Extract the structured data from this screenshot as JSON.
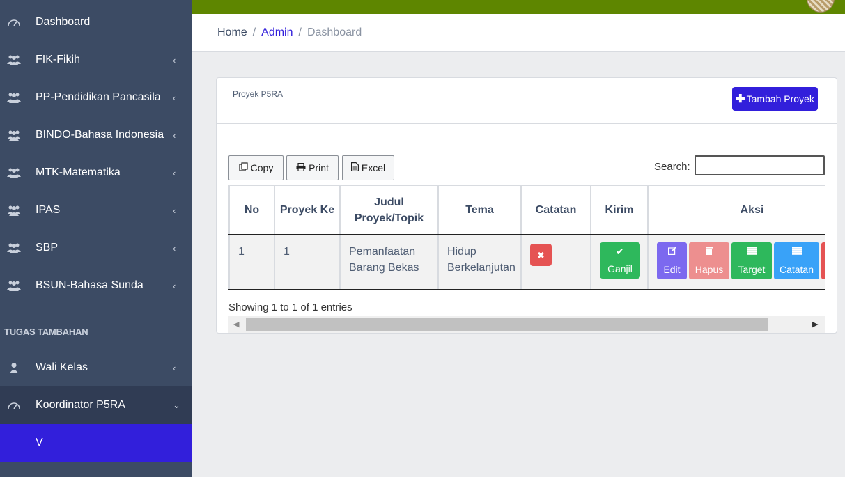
{
  "sidebar": {
    "items": [
      {
        "label": "Dashboard",
        "icon": "speedometer-icon"
      },
      {
        "label": "FIK-Fikih",
        "icon": "people-icon"
      },
      {
        "label": "PP-Pendidikan Pancasila",
        "icon": "people-icon"
      },
      {
        "label": "BINDO-Bahasa Indonesia",
        "icon": "people-icon"
      },
      {
        "label": "MTK-Matematika",
        "icon": "people-icon"
      },
      {
        "label": "IPAS",
        "icon": "people-icon"
      },
      {
        "label": "SBP",
        "icon": "people-icon"
      },
      {
        "label": "BSUN-Bahasa Sunda",
        "icon": "people-icon"
      }
    ],
    "section_title": "TUGAS TAMBAHAN",
    "wali_kelas": "Wali Kelas",
    "koordinator": "Koordinator P5RA",
    "sub_item": "V",
    "chevron_left": "‹",
    "chevron_down": "⌄"
  },
  "breadcrumb": {
    "home": "Home",
    "admin": "Admin",
    "current": "Dashboard",
    "separator": "/"
  },
  "card": {
    "title": "Proyek P5RA",
    "add_button": "Tambah Proyek"
  },
  "toolbar": {
    "copy": "Copy",
    "print": "Print",
    "excel": "Excel",
    "search_label": "Search:",
    "search_value": ""
  },
  "table": {
    "headers": [
      "No",
      "Proyek Ke",
      "Judul Proyek/Topik",
      "Tema",
      "Catatan",
      "Kirim",
      "Aksi"
    ],
    "rows": [
      {
        "no": "1",
        "proyek_ke": "1",
        "judul": "Pemanfaatan Barang Bekas",
        "tema": "Hidup Berkelanjutan",
        "kirim_label": "Ganjil",
        "actions": {
          "edit": "Edit",
          "hapus": "Hapus",
          "target": "Target",
          "catatan": "Catatan"
        }
      }
    ],
    "info": "Showing 1 to 1 of 1 entries"
  },
  "colors": {
    "sidebar_bg": "#3c4b64",
    "primary": "#321fdb",
    "topbar": "#5e8600",
    "success": "#2eb85c",
    "danger": "#e55353",
    "info": "#39a2f8"
  }
}
